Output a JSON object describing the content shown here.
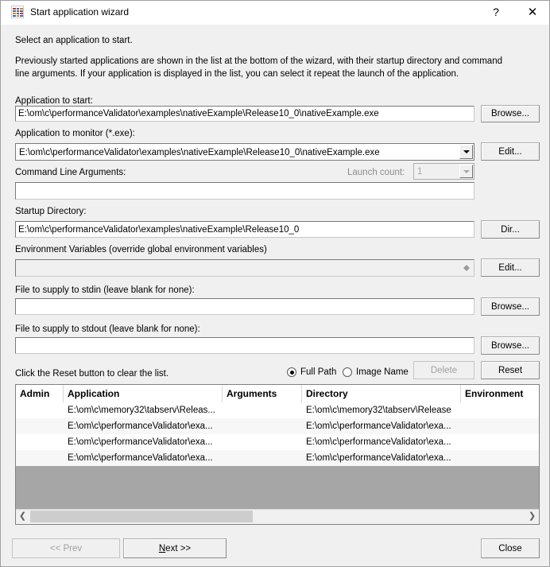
{
  "window": {
    "title": "Start application wizard",
    "icon": "chart-bars-icon",
    "help_button": "?",
    "close_button": "✕"
  },
  "intro": {
    "heading": "Select an application to start.",
    "body": "Previously started applications are shown in the list at the bottom of the wizard, with their startup directory and command line arguments. If your application is displayed in the list, you can select it repeat the launch of the application."
  },
  "fields": {
    "app_to_start": {
      "label": "Application to start:",
      "value": "E:\\om\\c\\performanceValidator\\examples\\nativeExample\\Release10_0\\nativeExample.exe",
      "button": "Browse..."
    },
    "app_to_monitor": {
      "label": "Application to monitor (*.exe):",
      "value": "E:\\om\\c\\performanceValidator\\examples\\nativeExample\\Release10_0\\nativeExample.exe",
      "button": "Edit..."
    },
    "command_line": {
      "label": "Command Line Arguments:",
      "value": ""
    },
    "launch_count": {
      "label": "Launch count:",
      "value": "1"
    },
    "startup_directory": {
      "label": "Startup Directory:",
      "value": "E:\\om\\c\\performanceValidator\\examples\\nativeExample\\Release10_0",
      "button": "Dir..."
    },
    "environment_variables": {
      "label": "Environment Variables (override global environment variables)",
      "value": "",
      "button": "Edit..."
    },
    "stdin": {
      "label": "File to supply to stdin (leave blank for none):",
      "value": "",
      "button": "Browse..."
    },
    "stdout": {
      "label": "File to supply to stdout (leave blank for none):",
      "value": "",
      "button": "Browse..."
    }
  },
  "list_controls": {
    "hint": "Click the Reset button to clear the list.",
    "radio_full_path": "Full Path",
    "radio_image_name": "Image Name",
    "radio_selected": "Full Path",
    "delete_button": "Delete",
    "reset_button": "Reset"
  },
  "list": {
    "columns": [
      "Admin",
      "Application",
      "Arguments",
      "Directory",
      "Environment"
    ],
    "rows": [
      {
        "admin": "",
        "application": "E:\\om\\c\\memory32\\tabserv\\Releas...",
        "arguments": "",
        "directory": "E:\\om\\c\\memory32\\tabserv\\Release",
        "environment": ""
      },
      {
        "admin": "",
        "application": "E:\\om\\c\\performanceValidator\\exa...",
        "arguments": "",
        "directory": "E:\\om\\c\\performanceValidator\\exa...",
        "environment": ""
      },
      {
        "admin": "",
        "application": "E:\\om\\c\\performanceValidator\\exa...",
        "arguments": "",
        "directory": "E:\\om\\c\\performanceValidator\\exa...",
        "environment": ""
      },
      {
        "admin": "",
        "application": "E:\\om\\c\\performanceValidator\\exa...",
        "arguments": "",
        "directory": "E:\\om\\c\\performanceValidator\\exa...",
        "environment": ""
      }
    ]
  },
  "footer": {
    "prev_button": "<< Prev",
    "next_button_mnemonic": "N",
    "next_button_rest": "ext >>",
    "close_button": "Close"
  },
  "colors": {
    "dialog_bg": "#f0f0f0",
    "titlebar_bg": "#ffffff",
    "list_empty_bg": "#a6a6a6",
    "row_alt_bg": "#f7f7f7",
    "disabled_text": "#a0a0a0"
  }
}
